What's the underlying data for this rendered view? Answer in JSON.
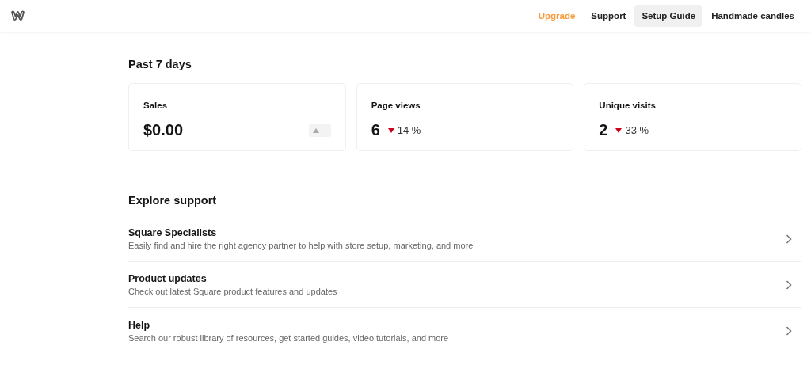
{
  "nav": [
    {
      "label": "Upgrade",
      "kind": "upgrade",
      "selected": false
    },
    {
      "label": "Support",
      "kind": "link",
      "selected": false
    },
    {
      "label": "Setup Guide",
      "kind": "link",
      "selected": true
    },
    {
      "label": "Handmade candles",
      "kind": "link",
      "selected": false
    }
  ],
  "stats_title": "Past 7 days",
  "stats": [
    {
      "label": "Sales",
      "value": "$0.00",
      "kind": "neutral",
      "change": "--"
    },
    {
      "label": "Page views",
      "value": "6",
      "kind": "down",
      "change": "14 %"
    },
    {
      "label": "Unique visits",
      "value": "2",
      "kind": "down",
      "change": "33 %"
    }
  ],
  "support_title": "Explore support",
  "support": [
    {
      "title": "Square Specialists",
      "description": "Easily find and hire the right agency partner to help with store setup, marketing, and more"
    },
    {
      "title": "Product updates",
      "description": "Check out latest Square product features and updates"
    },
    {
      "title": "Help",
      "description": "Search our robust library of resources, get started guides, video tutorials, and more"
    }
  ]
}
